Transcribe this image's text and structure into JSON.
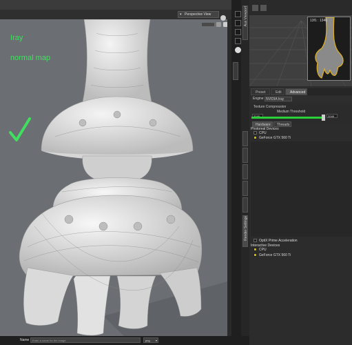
{
  "viewport": {
    "camera_view": "Perspective View",
    "overlay_line1": "Iray",
    "overlay_line2": "normal map",
    "check_color": "#3fe05f"
  },
  "vertical_tabs": {
    "aux_viewport": "Aux Viewport",
    "render_settings": "Render Settings"
  },
  "aux_preview": {
    "label": "13f1 : 1346"
  },
  "render_settings": {
    "tabs": [
      {
        "label": "Preset"
      },
      {
        "label": "Edit"
      },
      {
        "label": "Advanced"
      }
    ],
    "engine_label": "Engine",
    "engine_value": "NVIDIA Iray",
    "texture_compression_label": "Texture Compression",
    "medium_threshold_label": "Medium Threshold",
    "medium_value": "2048",
    "high_value": "2048",
    "hardware_tabs": [
      {
        "label": "Hardware"
      },
      {
        "label": "Threads"
      }
    ],
    "photoreal_devices_label": "Photoreal Devices",
    "photoreal_devices": [
      {
        "label": "CPU",
        "checked": false
      },
      {
        "label": "GeForce GTX 560 Ti",
        "checked": true
      }
    ],
    "optix_label": "OptiX Prime Acceleration",
    "interactive_devices_label": "Interactive Devices",
    "interactive_devices": [
      {
        "label": "CPU",
        "checked": true
      },
      {
        "label": "GeForce GTX 560 Ti",
        "checked": true
      }
    ],
    "accent_color": "#2bd13a"
  },
  "statusbar": {
    "name_label": "Name",
    "name_placeholder": "Enter a name for the image",
    "extension": "png"
  }
}
